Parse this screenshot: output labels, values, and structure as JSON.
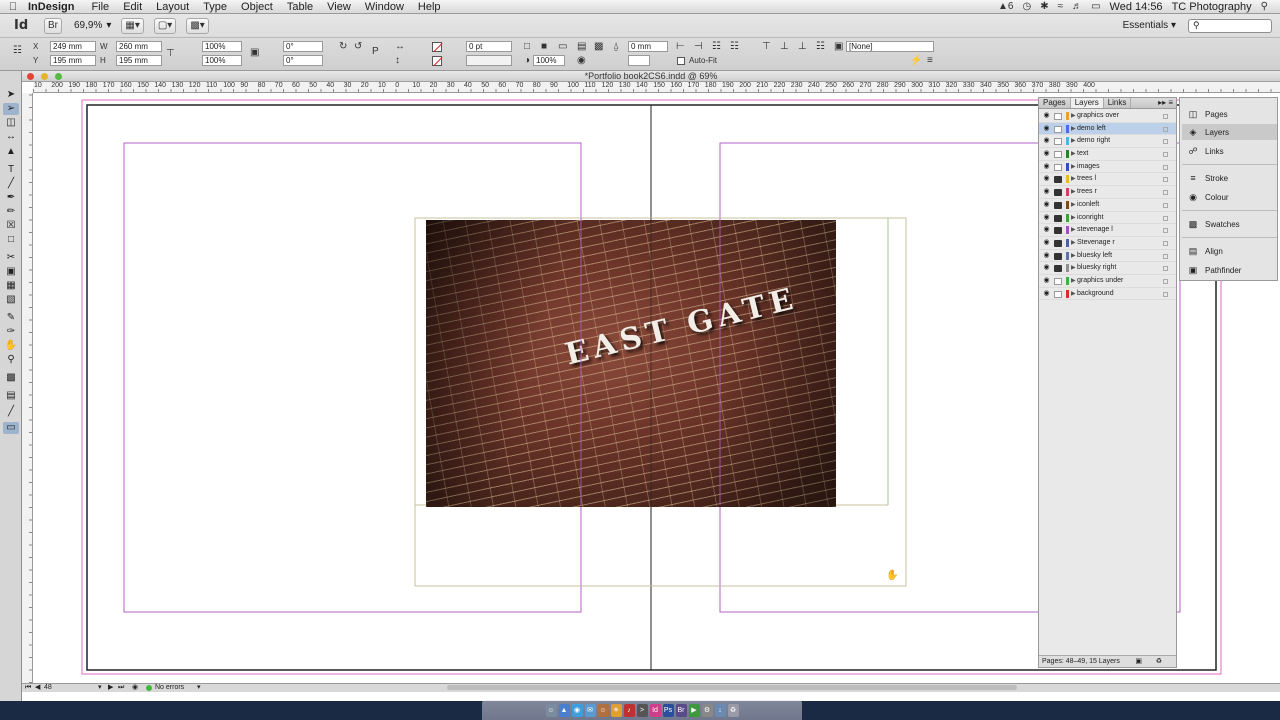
{
  "menubar": {
    "app_name": "InDesign",
    "menus": [
      "File",
      "Edit",
      "Layout",
      "Type",
      "Object",
      "Table",
      "View",
      "Window",
      "Help"
    ],
    "status_num": "6",
    "clock": "Wed 14:56",
    "user": "TC Photography"
  },
  "controlbar": {
    "logo": "Id",
    "zoom": "69,9%",
    "workspace": "Essentials",
    "search_placeholder": "",
    "x_label": "X",
    "y_label": "Y",
    "w_label": "W",
    "h_label": "H",
    "x_value": "249 mm",
    "y_value": "195 mm",
    "w_value": "260 mm",
    "h_value": "195 mm",
    "scale_x": "100%",
    "scale_y": "100%",
    "scale_x2": "100%",
    "scale_y2": "100%",
    "rotate": "0°",
    "shear": "0°",
    "stroke_weight": "0 pt",
    "opacity": "100%",
    "offset": "0 mm",
    "auto_fit": "Auto-Fit",
    "object_style": "[None]"
  },
  "document": {
    "title": "*Portfolio book2CS6.indd @ 69%",
    "ruler_labels": [
      "10",
      "200",
      "190",
      "180",
      "170",
      "160",
      "150",
      "140",
      "130",
      "120",
      "110",
      "100",
      "90",
      "80",
      "70",
      "60",
      "50",
      "40",
      "30",
      "20",
      "10",
      "0",
      "10",
      "20",
      "30",
      "40",
      "50",
      "60",
      "70",
      "80",
      "90",
      "100",
      "110",
      "120",
      "130",
      "140",
      "150",
      "160",
      "170",
      "180",
      "190",
      "200",
      "210",
      "220",
      "230",
      "240",
      "250",
      "260",
      "270",
      "280",
      "290",
      "300",
      "310",
      "320",
      "330",
      "340",
      "350",
      "360",
      "370",
      "380",
      "390",
      "400"
    ],
    "photo_sign": "EAST GATE"
  },
  "layers_panel": {
    "tabs": [
      "Pages",
      "Layers",
      "Links"
    ],
    "layers": [
      {
        "name": "graphics over",
        "locked": false,
        "color": "#e8a030"
      },
      {
        "name": "demo left",
        "locked": false,
        "color": "#4a6ee0",
        "selected": true
      },
      {
        "name": "demo right",
        "locked": false,
        "color": "#4ab8e0"
      },
      {
        "name": "text",
        "locked": false,
        "color": "#2e7d32"
      },
      {
        "name": "images",
        "locked": false,
        "color": "#3050c0"
      },
      {
        "name": "trees l",
        "locked": true,
        "color": "#e0c020"
      },
      {
        "name": "trees r",
        "locked": true,
        "color": "#d04060"
      },
      {
        "name": "iconleft",
        "locked": true,
        "color": "#7a4a20"
      },
      {
        "name": "iconright",
        "locked": true,
        "color": "#40a040"
      },
      {
        "name": "stevenage l",
        "locked": true,
        "color": "#a050c0"
      },
      {
        "name": "Stevenage r",
        "locked": true,
        "color": "#5060a0"
      },
      {
        "name": "bluesky left",
        "locked": true,
        "color": "#6070a8"
      },
      {
        "name": "bluesky right",
        "locked": true,
        "color": "#909090"
      },
      {
        "name": "graphics under",
        "locked": false,
        "color": "#40b040"
      },
      {
        "name": "background",
        "locked": false,
        "color": "#d03030"
      }
    ],
    "footer": "Pages: 48–49, 15 Layers"
  },
  "side_panels": {
    "items": [
      "Pages",
      "Layers",
      "Links",
      "Stroke",
      "Colour",
      "Swatches",
      "Align",
      "Pathfinder"
    ]
  },
  "statusbar": {
    "page": "48",
    "errors": "No errors"
  }
}
